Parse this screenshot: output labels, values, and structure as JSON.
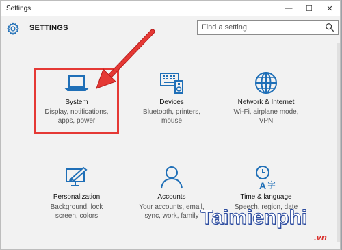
{
  "window": {
    "title": "Settings",
    "controls": [
      "—",
      "☐",
      "✕"
    ]
  },
  "header": {
    "title": "SETTINGS"
  },
  "search": {
    "placeholder": "Find a setting"
  },
  "tiles": [
    {
      "label": "System",
      "desc": [
        "Display, notifications,",
        "apps, power"
      ],
      "icon": "laptop-icon"
    },
    {
      "label": "Devices",
      "desc": [
        "Bluetooth, printers,",
        "mouse"
      ],
      "icon": "devices-icon"
    },
    {
      "label": "Network & Internet",
      "desc": [
        "Wi-Fi, airplane mode,",
        "VPN"
      ],
      "icon": "globe-icon"
    },
    {
      "label": "Personalization",
      "desc": [
        "Background, lock",
        "screen, colors"
      ],
      "icon": "paint-icon"
    },
    {
      "label": "Accounts",
      "desc": [
        "Your accounts, email,",
        "sync, work, family"
      ],
      "icon": "person-icon"
    },
    {
      "label": "Time & language",
      "desc": [
        "Speech, region, date"
      ],
      "icon": "clock-language-icon"
    }
  ],
  "watermark": {
    "brand": "Taimienphi",
    "suffix": ".vn"
  },
  "colors": {
    "accent": "#1f6fb7",
    "highlight": "#e53935"
  }
}
